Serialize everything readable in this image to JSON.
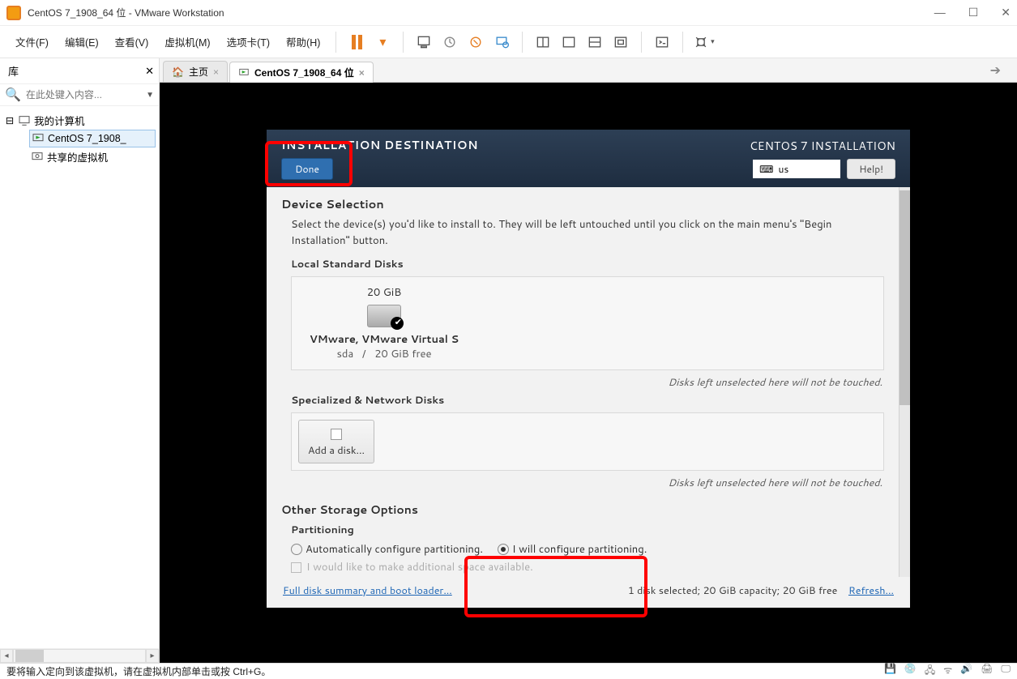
{
  "window": {
    "title": "CentOS 7_1908_64 位 - VMware Workstation"
  },
  "menu": {
    "file": "文件(F)",
    "edit": "编辑(E)",
    "view": "查看(V)",
    "vm": "虚拟机(M)",
    "tabs": "选项卡(T)",
    "help": "帮助(H)"
  },
  "library": {
    "title": "库",
    "search_placeholder": "在此处键入内容...",
    "items": {
      "my_computer": "我的计算机",
      "centos": "CentOS 7_1908_",
      "shared": "共享的虚拟机"
    }
  },
  "tabs": {
    "home": "主页",
    "centos": "CentOS 7_1908_64 位"
  },
  "installer": {
    "title": "INSTALLATION DESTINATION",
    "done": "Done",
    "suite": "CENTOS 7 INSTALLATION",
    "lang": "us",
    "help": "Help!",
    "device_selection": "Device Selection",
    "device_desc": "Select the device(s) you'd like to install to.  They will be left untouched until you click on the main menu's \"Begin Installation\" button.",
    "local_disks": "Local Standard Disks",
    "disk": {
      "capacity": "20 GiB",
      "name": "VMware, VMware Virtual S",
      "dev": "sda",
      "sep": "/",
      "free": "20 GiB free"
    },
    "unselected_hint": "Disks left unselected here will not be touched.",
    "network_disks": "Specialized & Network Disks",
    "add_disk": "Add a disk...",
    "other_storage": "Other Storage Options",
    "partitioning": "Partitioning",
    "auto_part": "Automatically configure partitioning.",
    "manual_part": "I will configure partitioning.",
    "extra_space": "I would like to make additional space available.",
    "footer_link": "Full disk summary and boot loader...",
    "footer_status": "1 disk selected; 20 GiB capacity; 20 GiB free",
    "refresh": "Refresh...",
    "kb_icon": "⌨"
  },
  "statusbar": {
    "hint1": "要将输入定向到该虚拟机，请在虚拟机内部单击或按 Ctrl+G。"
  }
}
